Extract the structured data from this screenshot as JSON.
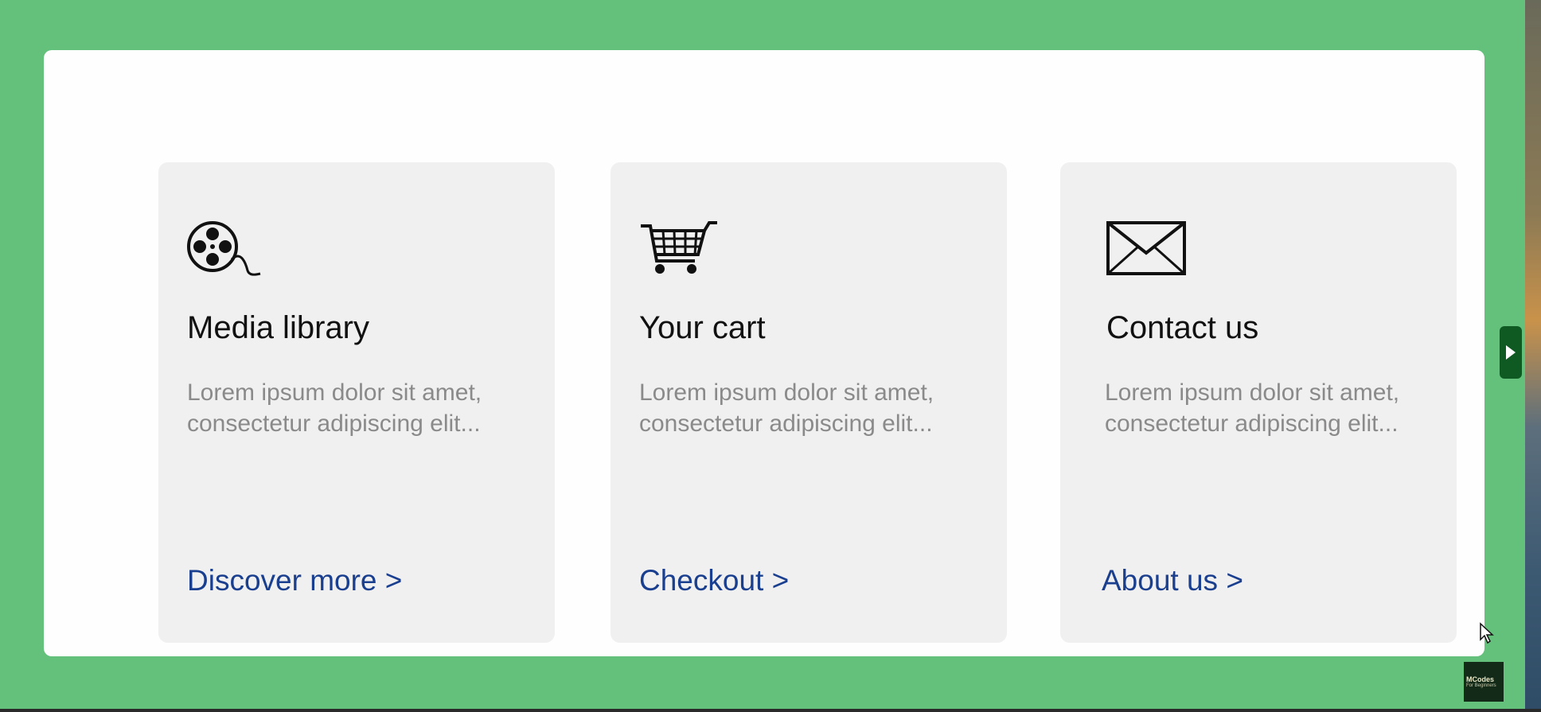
{
  "cards": [
    {
      "title": "Media library",
      "description": "Lorem ipsum dolor sit amet, consectetur adipiscing elit...",
      "link": "Discover more >",
      "icon": "film-reel-icon"
    },
    {
      "title": "Your cart",
      "description": "Lorem ipsum dolor sit amet, consectetur adipiscing elit...",
      "link": "Checkout >",
      "icon": "shopping-cart-icon"
    },
    {
      "title": "Contact us",
      "description": "Lorem ipsum dolor sit amet, consectetur adipiscing elit...",
      "link": "About us >",
      "icon": "envelope-icon"
    }
  ],
  "logo": {
    "text": "MCodes",
    "subtext": "For Beginners",
    "icon": "channel-logo"
  },
  "colors": {
    "background": "#64c17b",
    "panel": "#fefefe",
    "card": "#f1f0f1",
    "title": "#111111",
    "description": "#8a8a8a",
    "link": "#1a3f8e",
    "side_tab": "#0f5a22"
  }
}
